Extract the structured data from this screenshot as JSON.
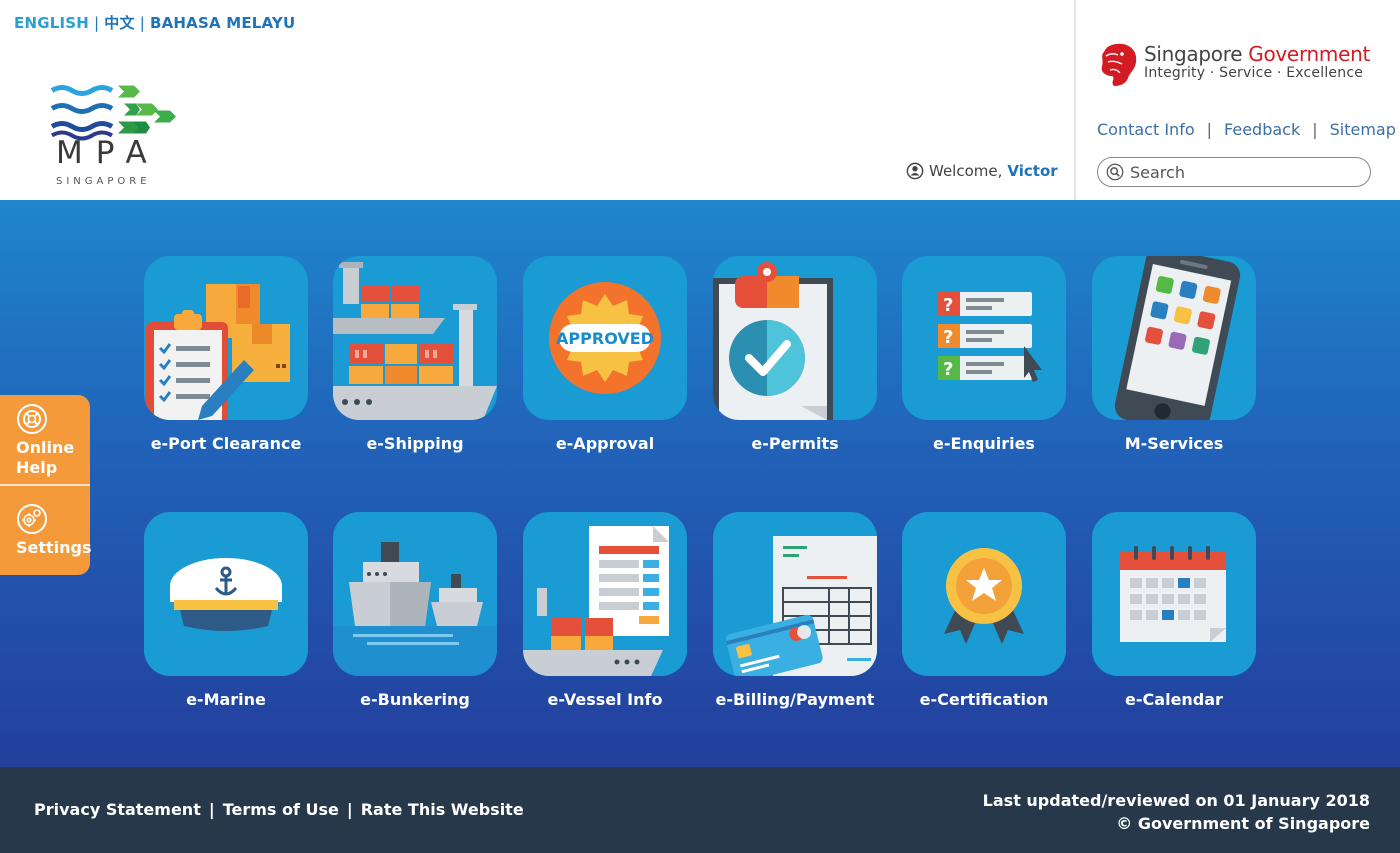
{
  "languages": [
    {
      "label": "ENGLISH",
      "active": true
    },
    {
      "label": "中文",
      "active": false
    },
    {
      "label": "BAHASA MELAYU",
      "active": false
    }
  ],
  "brand": {
    "mpa_name": "MPA",
    "mpa_sub": "SINGAPORE",
    "gov_title_part1": "Singapore ",
    "gov_title_part2": "Government",
    "gov_tagline": "Integrity · Service · Excellence"
  },
  "user": {
    "welcome_label": "Welcome,",
    "name": "Victor"
  },
  "utility_links": [
    "Contact Info",
    "Feedback",
    "Sitemap"
  ],
  "search": {
    "placeholder": "Search"
  },
  "tiles": [
    {
      "label": "e-Port Clearance",
      "icon": "clipboard-boxes-icon"
    },
    {
      "label": "e-Shipping",
      "icon": "container-ship-icon"
    },
    {
      "label": "e-Approval",
      "icon": "approved-stamp-icon"
    },
    {
      "label": "e-Permits",
      "icon": "clipboard-check-icon"
    },
    {
      "label": "e-Enquiries",
      "icon": "question-list-icon"
    },
    {
      "label": "M-Services",
      "icon": "mobile-phone-icon"
    },
    {
      "label": "e-Marine",
      "icon": "captain-hat-icon"
    },
    {
      "label": "e-Bunkering",
      "icon": "ships-on-water-icon"
    },
    {
      "label": "e-Vessel Info",
      "icon": "vessel-document-icon"
    },
    {
      "label": "e-Billing/Payment",
      "icon": "invoice-card-icon"
    },
    {
      "label": "e-Certification",
      "icon": "award-medal-icon"
    },
    {
      "label": "e-Calendar",
      "icon": "calendar-icon"
    }
  ],
  "approved_text": "APPROVED",
  "side_tab": {
    "help_line1": "Online",
    "help_line2": "Help",
    "settings": "Settings"
  },
  "footer": {
    "links": [
      "Privacy Statement",
      "Terms of Use",
      "Rate This Website"
    ],
    "updated": "Last updated/reviewed on 01 January 2018",
    "copyright": "© Government of Singapore"
  },
  "colors": {
    "accent_blue": "#1f73b8",
    "gov_red": "#d31b23",
    "side_tab_orange": "#f49a3a",
    "footer_bg": "#263849",
    "tile_bg": "#1a9bd3"
  }
}
